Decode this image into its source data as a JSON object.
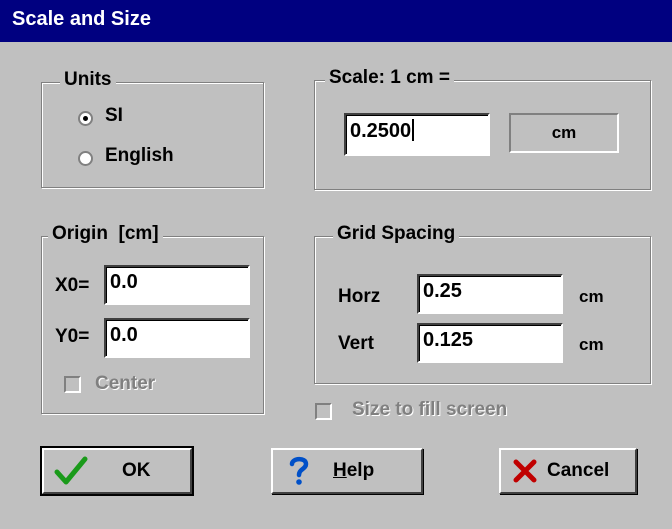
{
  "window": {
    "title": "Scale and Size"
  },
  "units": {
    "legend": "Units",
    "options": [
      {
        "label": "SI",
        "selected": true
      },
      {
        "label": "English",
        "selected": false
      }
    ]
  },
  "scale": {
    "legend": "Scale: 1 cm =",
    "value": "0.2500",
    "unit": "cm"
  },
  "origin": {
    "legend": "Origin  [cm]",
    "x0_label": "X0=",
    "x0_value": "0.0",
    "y0_label": "Y0=",
    "y0_value": "0.0",
    "center_label": "Center",
    "center_checked": false,
    "center_enabled": false
  },
  "grid": {
    "legend": "Grid Spacing",
    "horz_label": "Horz",
    "horz_value": "0.25",
    "horz_unit": "cm",
    "vert_label": "Vert",
    "vert_value": "0.125",
    "vert_unit": "cm"
  },
  "size_to_fill": {
    "label": "Size to fill screen",
    "checked": false,
    "enabled": false
  },
  "buttons": {
    "ok": "OK",
    "help_first": "H",
    "help_rest": "elp",
    "cancel": "Cancel"
  },
  "colors": {
    "title_bar": "#000080",
    "face": "#c0c0c0",
    "check_green": "#1a9a1a",
    "help_blue": "#0050c8",
    "cancel_red": "#c00000"
  },
  "icons": {
    "ok": "checkmark-icon",
    "help": "question-mark-icon",
    "cancel": "x-icon"
  }
}
